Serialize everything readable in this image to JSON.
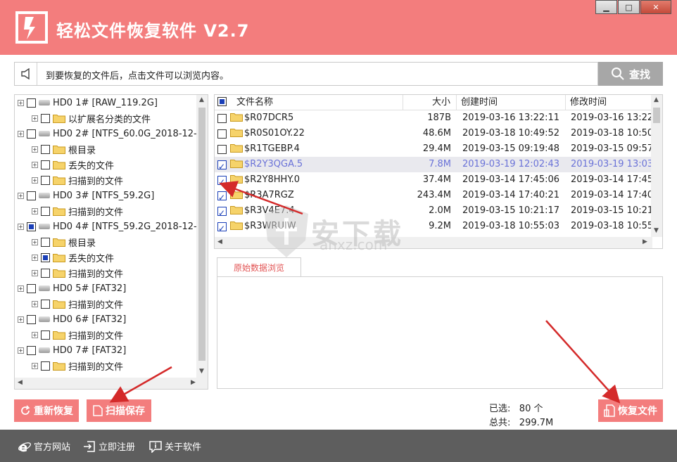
{
  "app": {
    "title": "轻松文件恢复软件 V2.7",
    "window_buttons": [
      "minimize",
      "maximize",
      "close"
    ]
  },
  "hint": {
    "text": "到要恢复的文件后，点击文件可以浏览内容。",
    "search_label": "查找"
  },
  "tree": [
    {
      "level": 0,
      "text": "HD0   1# [RAW_119.2G]",
      "type": "disk",
      "state": "none"
    },
    {
      "level": 1,
      "text": "以扩展名分类的文件",
      "type": "folder",
      "state": "none"
    },
    {
      "level": 0,
      "text": "HD0   2# [NTFS_60.0G_2018-12-",
      "type": "disk",
      "state": "none"
    },
    {
      "level": 1,
      "text": "根目录",
      "type": "folder",
      "state": "none"
    },
    {
      "level": 1,
      "text": "丢失的文件",
      "type": "folder",
      "state": "none"
    },
    {
      "level": 1,
      "text": "扫描到的文件",
      "type": "folder",
      "state": "none"
    },
    {
      "level": 0,
      "text": "HD0   3# [NTFS_59.2G]",
      "type": "disk",
      "state": "none"
    },
    {
      "level": 1,
      "text": "扫描到的文件",
      "type": "folder",
      "state": "none"
    },
    {
      "level": 0,
      "text": "HD0   4# [NTFS_59.2G_2018-12-",
      "type": "disk",
      "state": "partial"
    },
    {
      "level": 1,
      "text": "根目录",
      "type": "folder",
      "state": "none"
    },
    {
      "level": 1,
      "text": "丢失的文件",
      "type": "folder",
      "state": "partial"
    },
    {
      "level": 1,
      "text": "扫描到的文件",
      "type": "folder",
      "state": "none"
    },
    {
      "level": 0,
      "text": "HD0   5# [FAT32]",
      "type": "disk",
      "state": "none"
    },
    {
      "level": 1,
      "text": "扫描到的文件",
      "type": "folder",
      "state": "none"
    },
    {
      "level": 0,
      "text": "HD0   6# [FAT32]",
      "type": "disk",
      "state": "none"
    },
    {
      "level": 1,
      "text": "扫描到的文件",
      "type": "folder",
      "state": "none"
    },
    {
      "level": 0,
      "text": "HD0   7# [FAT32]",
      "type": "disk",
      "state": "none"
    },
    {
      "level": 1,
      "text": "扫描到的文件",
      "type": "folder",
      "state": "none"
    }
  ],
  "files": {
    "columns": [
      "文件名称",
      "大小",
      "创建时间",
      "修改时间"
    ],
    "rows": [
      {
        "name": "$R07DCR5",
        "size": "187B",
        "created": "2019-03-16 13:22:11",
        "modified": "2019-03-16 13:22",
        "checked": false,
        "selected": false
      },
      {
        "name": "$R0S01OY.22",
        "size": "48.6M",
        "created": "2019-03-18 10:49:52",
        "modified": "2019-03-18 10:50",
        "checked": false,
        "selected": false
      },
      {
        "name": "$R1TGEBP.4",
        "size": "29.4M",
        "created": "2019-03-15 09:19:48",
        "modified": "2019-03-15 09:57",
        "checked": false,
        "selected": false
      },
      {
        "name": "$R2Y3QGA.5",
        "size": "7.8M",
        "created": "2019-03-19 12:02:43",
        "modified": "2019-03-19 13:03",
        "checked": true,
        "selected": true
      },
      {
        "name": "$R2Y8HHY.0",
        "size": "37.4M",
        "created": "2019-03-14 17:45:06",
        "modified": "2019-03-14 17:45",
        "checked": true,
        "selected": false
      },
      {
        "name": "$R3A7RGZ",
        "size": "243.4M",
        "created": "2019-03-14 17:40:21",
        "modified": "2019-03-14 17:40",
        "checked": true,
        "selected": false
      },
      {
        "name": "$R3V4E7.4",
        "size": "2.0M",
        "created": "2019-03-15 10:21:17",
        "modified": "2019-03-15 10:21",
        "checked": true,
        "selected": false
      },
      {
        "name": "$R3WRUIW",
        "size": "9.2M",
        "created": "2019-03-18 10:55:03",
        "modified": "2019-03-18 10:55",
        "checked": true,
        "selected": false
      }
    ]
  },
  "preview": {
    "tab_label": "原始数据浏览"
  },
  "actions": {
    "rescan_label": "重新恢复",
    "save_scan_label": "扫描保存",
    "recover_label": "恢复文件"
  },
  "stats": {
    "selected_label": "已选:",
    "selected_value": "80 个",
    "total_label": "总共:",
    "total_value": "299.7M"
  },
  "footer": {
    "website_label": "官方网站",
    "register_label": "立即注册",
    "about_label": "关于软件"
  },
  "watermark": {
    "text": "安下载",
    "sub": "anxz.com"
  },
  "colors": {
    "accent": "#f37d7d",
    "footer": "#5e5e5e",
    "selection_text": "#6a72d8",
    "check": "#1a3fb8"
  }
}
